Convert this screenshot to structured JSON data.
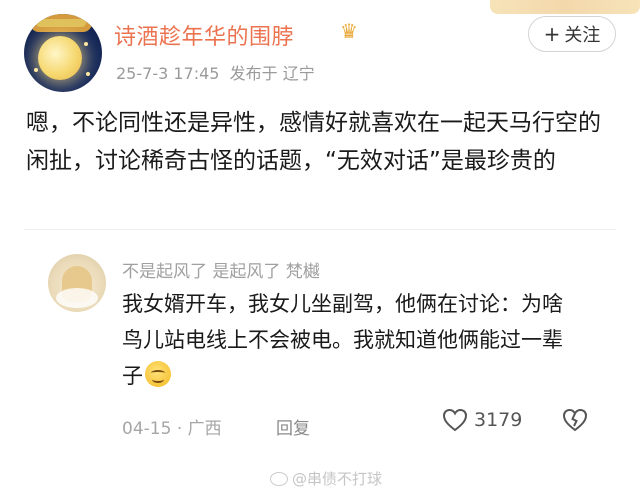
{
  "post": {
    "username": "诗酒趁年华的围脖",
    "crown_icon": "crown-icon",
    "timestamp": "25-7-3 17:45",
    "location": "发布于 辽宁",
    "follow_label": "关注",
    "follow_plus": "+",
    "text": "嗯，不论同性还是异性，感情好就喜欢在一起天马行空的闲扯，讨论稀奇古怪的话题，“无效对话”是最珍贵的"
  },
  "comment": {
    "names": "不是起风了 是起风了 梵樾",
    "text": "我女婿开车，我女儿坐副驾，他俩在讨论：为啥鸟儿站电线上不会被电。我就知道他俩能过一辈子",
    "emoji": "grinning-emoji",
    "date": "04-15",
    "separator": "·",
    "location": "广西",
    "reply_label": "回复",
    "like_count": "3179"
  },
  "watermark": {
    "text": "@串债不打球"
  },
  "colors": {
    "username": "#eb7350",
    "meta": "#9a9a9a",
    "text": "#1a1a1a"
  }
}
